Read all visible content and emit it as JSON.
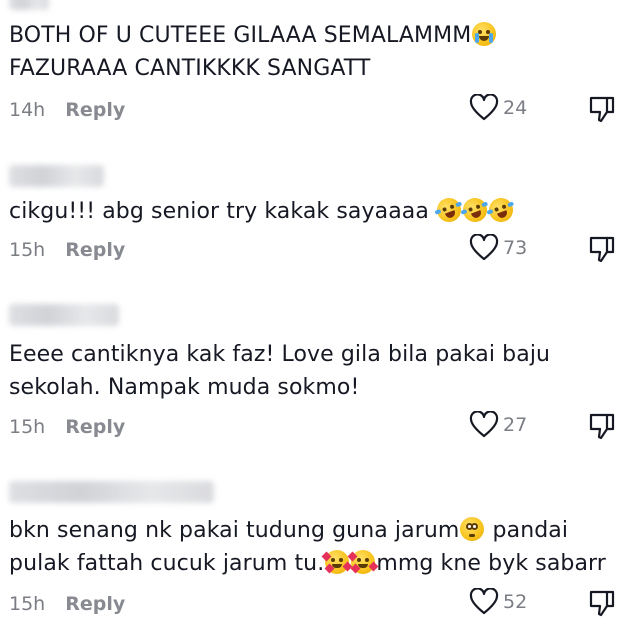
{
  "colors": {
    "text": "#161823",
    "meta": "#7b7d84",
    "background": "#ffffff"
  },
  "comments": [
    {
      "text_lines": [
        "BOTH OF U CUTEEE GILAAA SEMALAMMM",
        "FAZURAAA CANTIKKKK SANGATT"
      ],
      "emojis": [
        "loudly-crying-face"
      ],
      "time": "14h",
      "reply": "Reply",
      "likes": "24"
    },
    {
      "text_lines": [
        "cikgu!!! abg senior try kakak sayaaaa"
      ],
      "emojis": [
        "rolling-on-floor-laughing",
        "rolling-on-floor-laughing",
        "rolling-on-floor-laughing"
      ],
      "time": "15h",
      "reply": "Reply",
      "likes": "73"
    },
    {
      "text_lines": [
        "Eeee cantiknya kak faz! Love gila bila pakai baju",
        "sekolah. Nampak muda sokmo!"
      ],
      "emojis": [],
      "time": "15h",
      "reply": "Reply",
      "likes": "27"
    },
    {
      "text_lines": [
        "bkn senang nk pakai tudung guna jarum",
        "pandai",
        "pulak fattah cucuk jarum tu.",
        "mmg kne byk sabarr"
      ],
      "emojis": [
        "flushed-face",
        "smiling-face-with-hearts",
        "smiling-face-with-hearts"
      ],
      "time": "15h",
      "reply": "Reply",
      "likes": "52"
    }
  ]
}
